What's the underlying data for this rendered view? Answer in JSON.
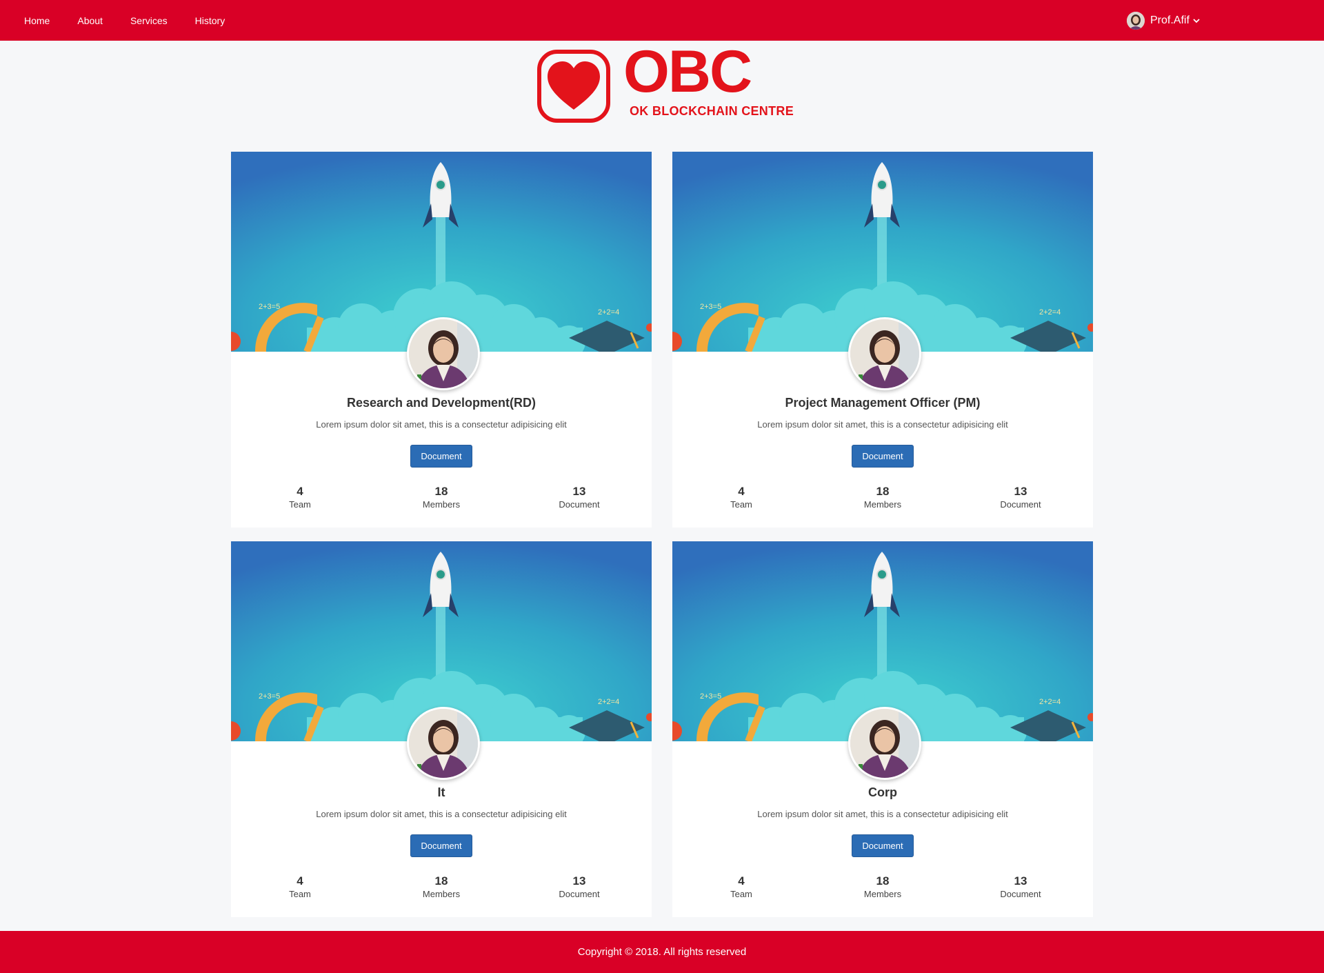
{
  "nav": {
    "links": [
      "Home",
      "About",
      "Services",
      "History"
    ],
    "user_name": "Prof.Afif",
    "user_icon": "user-avatar",
    "dropdown_icon": "chevron-down-icon"
  },
  "logo": {
    "word": "OBC",
    "subtitle": "OK BLOCKCHAIN CENTRE",
    "icon": "heart-icon",
    "color": "#e3131b"
  },
  "theme": {
    "nav_bg": "#d90026",
    "button_bg": "#2b6cb5"
  },
  "cards": [
    {
      "title": "Research and Development(RD)",
      "description": "Lorem ipsum dolor sit amet, this is a consectetur adipisicing elit",
      "button": "Document",
      "stats": [
        {
          "value": "4",
          "label": "Team"
        },
        {
          "value": "18",
          "label": "Members"
        },
        {
          "value": "13",
          "label": "Document"
        }
      ]
    },
    {
      "title": "Project Management Officer (PM)",
      "description": "Lorem ipsum dolor sit amet, this is a consectetur adipisicing elit",
      "button": "Document",
      "stats": [
        {
          "value": "4",
          "label": "Team"
        },
        {
          "value": "18",
          "label": "Members"
        },
        {
          "value": "13",
          "label": "Document"
        }
      ]
    },
    {
      "title": "It",
      "description": "Lorem ipsum dolor sit amet, this is a consectetur adipisicing elit",
      "button": "Document",
      "stats": [
        {
          "value": "4",
          "label": "Team"
        },
        {
          "value": "18",
          "label": "Members"
        },
        {
          "value": "13",
          "label": "Document"
        }
      ]
    },
    {
      "title": "Corp",
      "description": "Lorem ipsum dolor sit amet, this is a consectetur adipisicing elit",
      "button": "Document",
      "stats": [
        {
          "value": "4",
          "label": "Team"
        },
        {
          "value": "18",
          "label": "Members"
        },
        {
          "value": "13",
          "label": "Document"
        }
      ]
    }
  ],
  "cover_labels": {
    "left": "2+3=5",
    "right": "2+2=4"
  },
  "footer": {
    "text": "Copyright © 2018. All rights reserved"
  }
}
